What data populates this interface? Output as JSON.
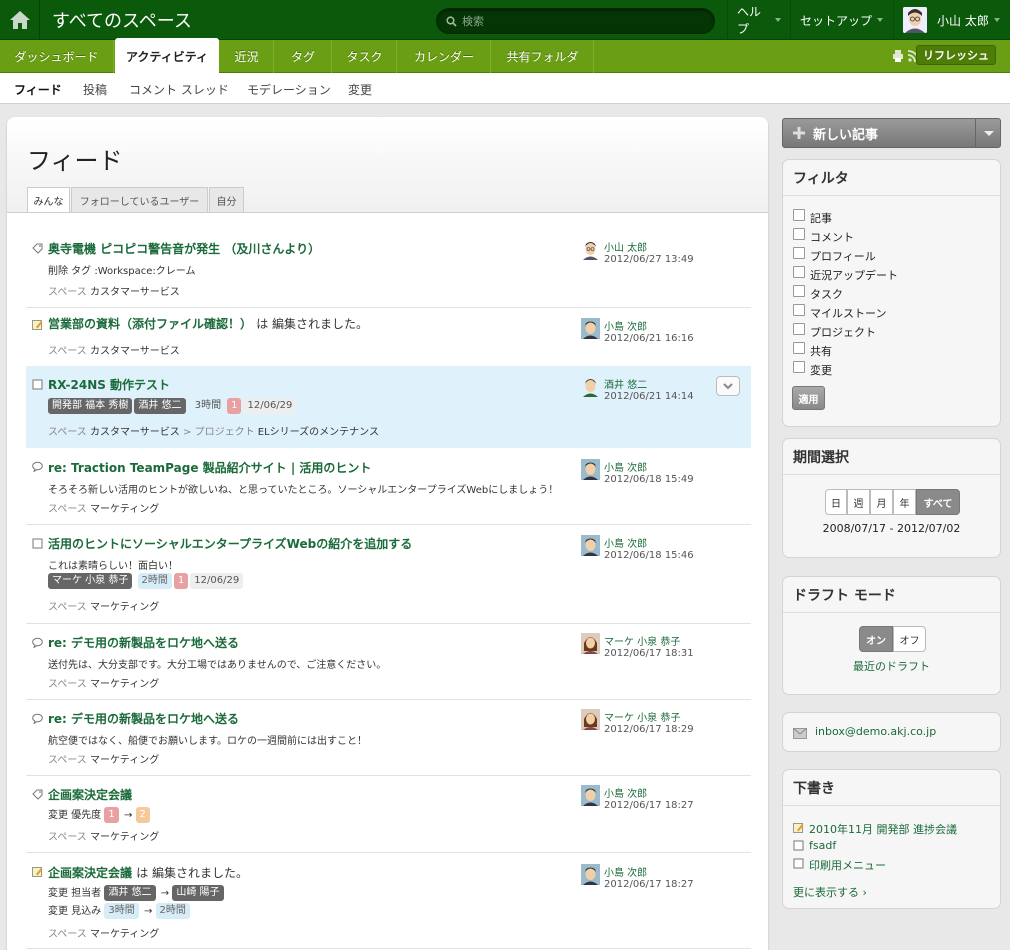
{
  "header": {
    "space_title": "すべてのスペース",
    "search_placeholder": "検索",
    "help": "ヘルプ",
    "setup": "セットアップ",
    "user": "小山 太郎"
  },
  "nav": {
    "tabs": [
      "ダッシュボード",
      "アクティビティ",
      "近況",
      "タグ",
      "タスク",
      "カレンダー",
      "共有フォルダ"
    ],
    "active": "アクティビティ",
    "refresh": "リフレッシュ"
  },
  "subnav": {
    "items": [
      "フィード",
      "投稿",
      "コメント スレッド",
      "モデレーション",
      "変更"
    ],
    "active": "フィード"
  },
  "main": {
    "title": "フィード",
    "filter_tabs": [
      "みんな",
      "フォローしているユーザー",
      "自分"
    ]
  },
  "feed": [
    {
      "title": "奥寺電機 ピコピコ警告音が発生 （及川さんより）",
      "line1": "削除 タグ :Workspace:クレーム",
      "space_label": "スペース",
      "space": "カスタマーサービス",
      "author": "小山 太郎",
      "date": "2012/06/27 13:49",
      "icon": "tag-icon"
    },
    {
      "title": "営業部の資料（添付ファイル確認！）",
      "title_suffix": "は 編集されました。",
      "space_label": "スペース",
      "space": "カスタマーサービス",
      "author": "小島 次郎",
      "date": "2012/06/21 16:16",
      "icon": "edit-icon"
    },
    {
      "title": "RX-24NS 動作テスト",
      "chips": [
        "開発部 福本 秀樹",
        "酒井 悠二"
      ],
      "duration": "3時間",
      "count": "1",
      "due": "12/06/29",
      "space_label": "スペース",
      "space": "カスタマーサービス",
      "space_sep": ">",
      "project_label": "プロジェクト",
      "project": "ELシリーズのメンテナンス",
      "author": "酒井 悠二",
      "date": "2012/06/21 14:14",
      "icon": "task-icon"
    },
    {
      "title": "re: Traction TeamPage 製品紹介サイト | 活用のヒント",
      "line1": "そろそろ新しい活用のヒントが欲しいね、と思っていたところ。ソーシャルエンタープライズWebにしましょう！",
      "space_label": "スペース",
      "space": "マーケティング",
      "author": "小島 次郎",
      "date": "2012/06/18 15:49",
      "icon": "comment-icon"
    },
    {
      "title": "活用のヒントにソーシャルエンタープライズWebの紹介を追加する",
      "line1": "これは素晴らしい！面白い！",
      "chips": [
        "マーケ 小泉 恭子"
      ],
      "duration": "2時間",
      "count": "1",
      "due": "12/06/29",
      "space_label": "スペース",
      "space": "マーケティング",
      "author": "小島 次郎",
      "date": "2012/06/18 15:46",
      "icon": "task-icon"
    },
    {
      "title": "re: デモ用の新製品をロケ地へ送る",
      "line1": "送付先は、大分支部です。大分工場ではありませんので、ご注意ください。",
      "space_label": "スペース",
      "space": "マーケティング",
      "author": "マーケ 小泉 恭子",
      "date": "2012/06/17 18:31",
      "icon": "comment-icon"
    },
    {
      "title": "re: デモ用の新製品をロケ地へ送る",
      "line1": "航空便ではなく、船便でお願いします。ロケの一週間前には出すこと！",
      "space_label": "スペース",
      "space": "マーケティング",
      "author": "マーケ 小泉 恭子",
      "date": "2012/06/17 18:29",
      "icon": "comment-icon"
    },
    {
      "title": "企画案決定会議",
      "line1_label": "変更 優先度",
      "from": "1",
      "arrow": "→",
      "to": "2",
      "space_label": "スペース",
      "space": "マーケティング",
      "author": "小島 次郎",
      "date": "2012/06/17 18:27",
      "icon": "tag-icon"
    },
    {
      "title": "企画案決定会議",
      "title_suffix": "は 編集されました。",
      "line1_label": "変更 担当者",
      "from": "酒井 悠二",
      "arrow": "→",
      "to": "山崎 陽子",
      "line2_label": "変更 見込み",
      "from2": "3時間",
      "to2": "2時間",
      "space_label": "スペース",
      "space": "マーケティング",
      "author": "小島 次郎",
      "date": "2012/06/17 18:27",
      "icon": "edit-icon"
    }
  ],
  "sidebar": {
    "new_post": "新しい記事",
    "filter": {
      "title": "フィルタ",
      "items": [
        "記事",
        "コメント",
        "プロフィール",
        "近況アップデート",
        "タスク",
        "マイルストーン",
        "プロジェクト",
        "共有",
        "変更"
      ],
      "apply": "適用"
    },
    "period": {
      "title": "期間選択",
      "options": [
        "日",
        "週",
        "月",
        "年",
        "すべて"
      ],
      "active": "すべて",
      "range": "2008/07/17 - 2012/07/02"
    },
    "draft_mode": {
      "title": "ドラフト モード",
      "on": "オン",
      "off": "オフ",
      "link": "最近のドラフト"
    },
    "inbox": "inbox@demo.akj.co.jp",
    "drafts": {
      "title": "下書き",
      "items": [
        "2010年11月 開発部 進捗会議",
        "fsadf",
        "印刷用メニュー"
      ],
      "more": "更に表示する"
    }
  },
  "colors": {
    "topbar": "#0b5a0b",
    "nav": "#6a9e14",
    "link": "#1a6a3a",
    "highlight": "#dff1fb"
  }
}
